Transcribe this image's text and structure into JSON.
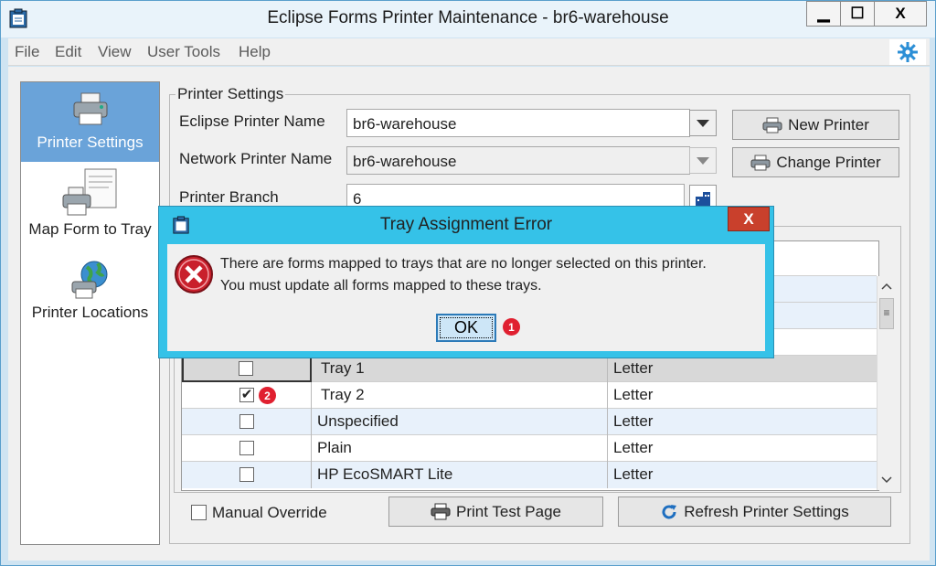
{
  "window": {
    "title": "Eclipse Forms Printer Maintenance - br6-warehouse"
  },
  "window_controls": {
    "minimize": "▁",
    "maximize": "☐",
    "close": "X"
  },
  "menu": [
    "File",
    "Edit",
    "View",
    "User Tools",
    "Help"
  ],
  "sidebar": {
    "items": [
      {
        "label": "Printer Settings",
        "icon": "printer-icon",
        "active": true
      },
      {
        "label": "Map Form to Tray",
        "icon": "printer-form-icon",
        "active": false
      },
      {
        "label": "Printer Locations",
        "icon": "globe-printer-icon",
        "active": false
      }
    ]
  },
  "printer_settings": {
    "group_label": "Printer Settings",
    "eclipse_printer_name_label": "Eclipse Printer Name",
    "eclipse_printer_name_value": "br6-warehouse",
    "network_printer_name_label": "Network Printer Name",
    "network_printer_name_value": "br6-warehouse",
    "printer_branch_label": "Printer Branch",
    "printer_branch_value": "6",
    "new_printer_label": "New Printer",
    "change_printer_label": "Change Printer"
  },
  "trays": {
    "rows": [
      {
        "checked": false,
        "tray": "Tray 1",
        "paper": "Letter"
      },
      {
        "checked": true,
        "tray": "Tray 2",
        "paper": "Letter"
      },
      {
        "checked": false,
        "tray": "Unspecified",
        "paper": "Letter"
      },
      {
        "checked": false,
        "tray": "Plain",
        "paper": "Letter"
      },
      {
        "checked": false,
        "tray": "HP EcoSMART Lite",
        "paper": "Letter"
      }
    ]
  },
  "bottom": {
    "manual_override_label": "Manual Override",
    "print_test_page_label": "Print Test Page",
    "refresh_label": "Refresh Printer Settings"
  },
  "dialog": {
    "title": "Tray Assignment Error",
    "close": "X",
    "line1": "There are forms mapped to trays that are no longer selected on this printer.",
    "line2": "You must update all forms mapped to these trays.",
    "ok_label": "OK"
  },
  "badges": {
    "ok_badge": "1",
    "tray2_badge": "2"
  },
  "colors": {
    "accent": "#6aa3d9",
    "dialog_frame": "#35c2e8",
    "error": "#c9202c",
    "badge": "#e02030"
  }
}
